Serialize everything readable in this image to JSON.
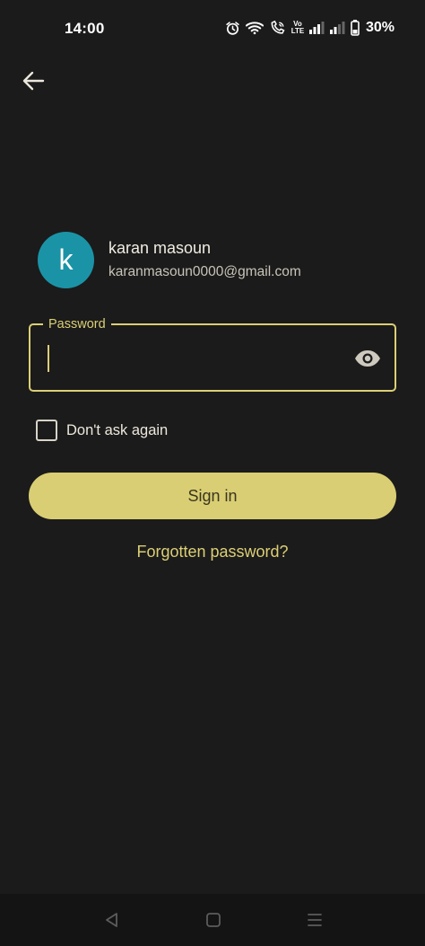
{
  "status_bar": {
    "time": "14:00",
    "volte_top": "Vo",
    "volte_bottom": "LTE",
    "battery_percent": "30%",
    "icons": [
      "alarm-icon",
      "wifi-icon",
      "wifi-call-icon",
      "volte-icon",
      "signal-icon",
      "signal-icon",
      "battery-icon"
    ]
  },
  "header": {
    "back_icon": "back-arrow-icon"
  },
  "account": {
    "avatar_letter": "k",
    "avatar_color": "#1b93a6",
    "name": "karan masoun",
    "email": "karanmasoun0000@gmail.com"
  },
  "password": {
    "label": "Password",
    "value": "",
    "toggle_icon": "eye-icon"
  },
  "remember": {
    "label": "Don't ask again",
    "checked": false
  },
  "actions": {
    "sign_in_label": "Sign in",
    "forgot_label": "Forgotten password?"
  },
  "colors": {
    "accent": "#dccf75",
    "button_bg": "#d9ce73",
    "background": "#1b1b1b"
  },
  "nav_bar": {
    "icons": [
      "back-triangle-icon",
      "home-square-icon",
      "recents-menu-icon"
    ]
  }
}
